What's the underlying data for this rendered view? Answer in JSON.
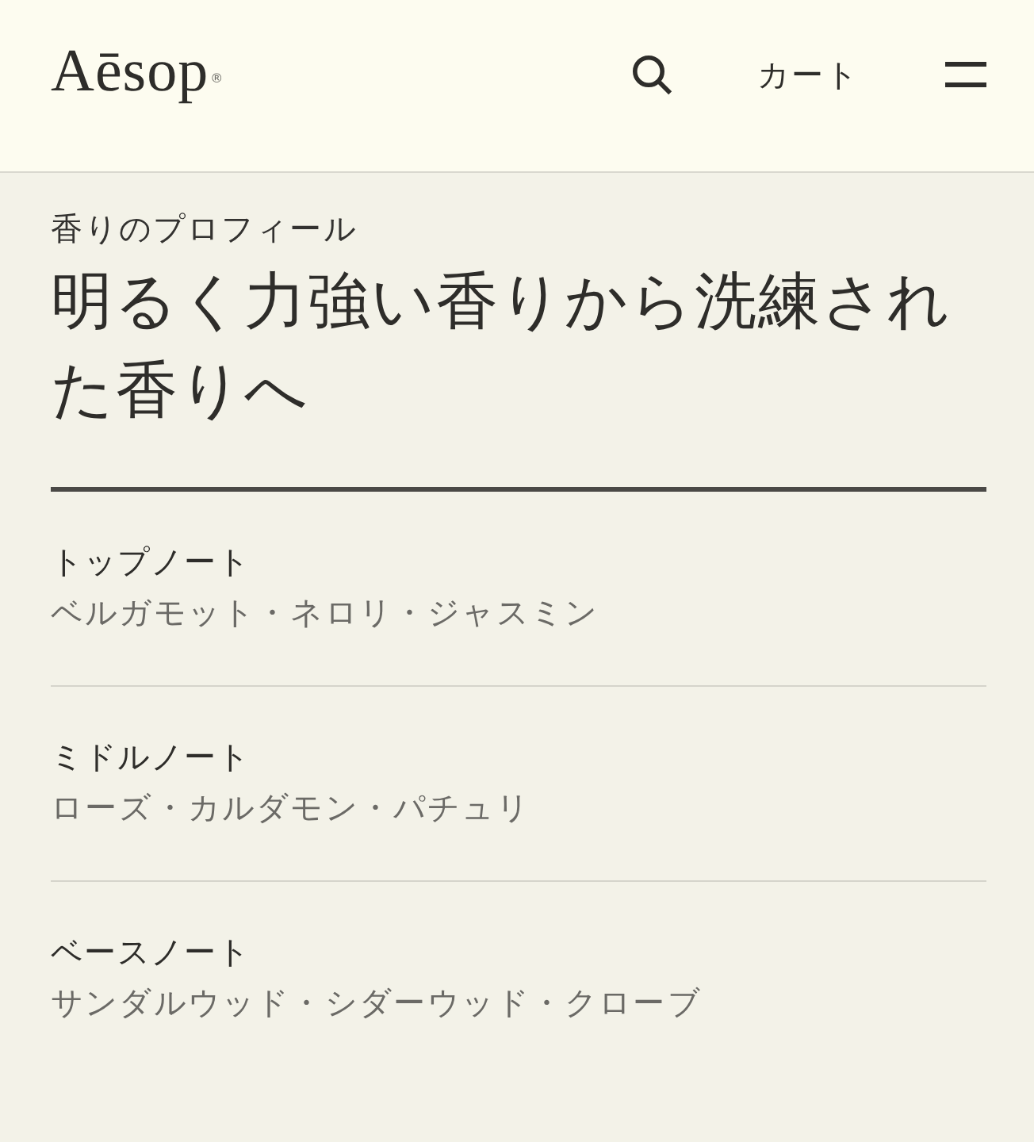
{
  "header": {
    "logo": {
      "text": "Aēsop",
      "mark": "®"
    },
    "cart": "カート"
  },
  "profile": {
    "eyebrow": "香りのプロフィール",
    "heading": "明るく力強い香りから洗練された香りへ"
  },
  "notes": [
    {
      "label": "トップノート",
      "value": "ベルガモット・ネロリ・ジャスミン"
    },
    {
      "label": "ミドルノート",
      "value": "ローズ・カルダモン・パチュリ"
    },
    {
      "label": "ベースノート",
      "value": "サンダルウッド・シダーウッド・クローブ"
    }
  ]
}
